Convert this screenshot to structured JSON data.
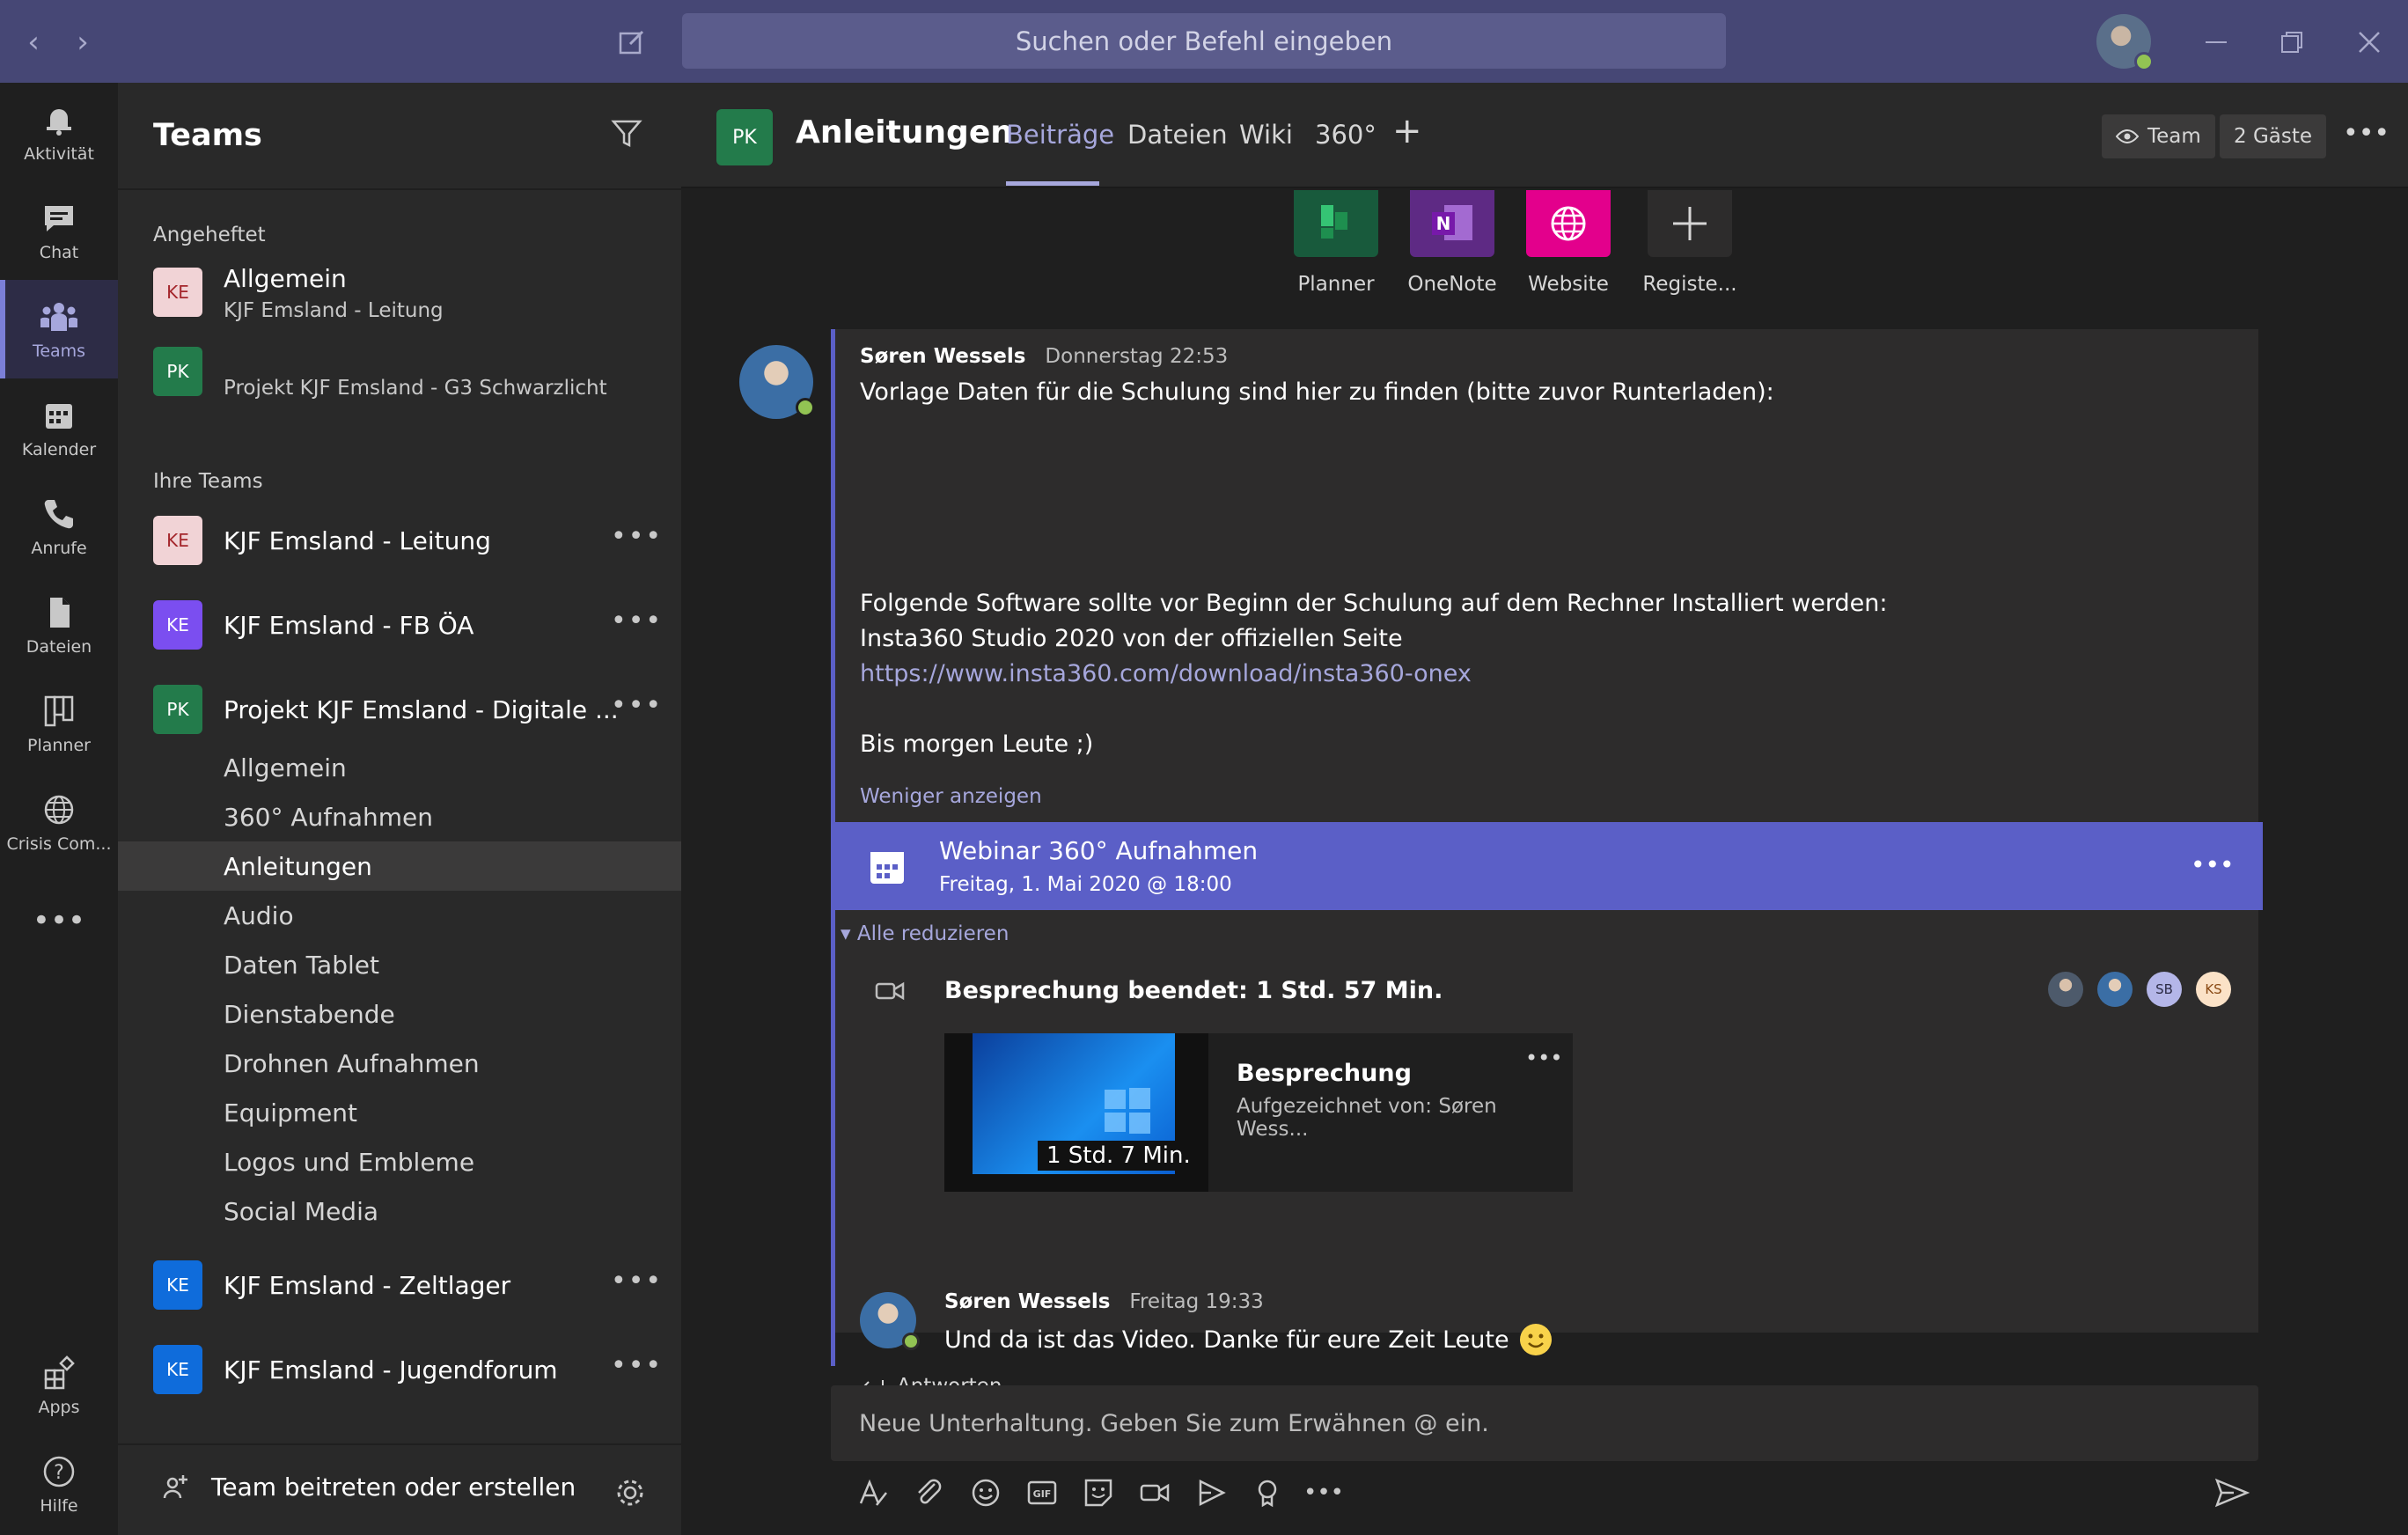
{
  "search": {
    "placeholder": "Suchen oder Befehl eingeben"
  },
  "rail": [
    {
      "label": "Aktivität",
      "icon": "bell-icon"
    },
    {
      "label": "Chat",
      "icon": "chat-icon"
    },
    {
      "label": "Teams",
      "icon": "teams-icon",
      "active": true
    },
    {
      "label": "Kalender",
      "icon": "calendar-icon"
    },
    {
      "label": "Anrufe",
      "icon": "phone-icon"
    },
    {
      "label": "Dateien",
      "icon": "file-icon"
    },
    {
      "label": "Planner",
      "icon": "planner-icon"
    },
    {
      "label": "Crisis Com...",
      "icon": "globe-icon"
    },
    {
      "label": "Apps",
      "icon": "apps-icon"
    },
    {
      "label": "Hilfe",
      "icon": "help-icon"
    }
  ],
  "pane": {
    "title": "Teams",
    "pinned_label": "Angeheftet",
    "pinned": [
      {
        "tile": "KE",
        "name": "Allgemein",
        "sub": "KJF Emsland - Leitung"
      },
      {
        "tile": "PK",
        "name": "",
        "sub": "Projekt KJF Emsland - G3 Schwarzlicht"
      }
    ],
    "your_teams_label": "Ihre Teams",
    "teams": [
      {
        "tile": "KE",
        "name": "KJF Emsland - Leitung"
      },
      {
        "tile": "KE",
        "name": "KJF Emsland - FB ÖA"
      },
      {
        "tile": "PK",
        "name": "Projekt KJF Emsland - Digitale ..."
      }
    ],
    "channels": [
      "Allgemein",
      "360° Aufnahmen",
      "Anleitungen",
      "Audio",
      "Daten Tablet",
      "Dienstabende",
      "Drohnen Aufnahmen",
      "Equipment",
      "Logos und Embleme",
      "Social Media"
    ],
    "teams_after": [
      {
        "tile": "KE",
        "name": "KJF Emsland - Zeltlager"
      },
      {
        "tile": "KE",
        "name": "KJF Emsland - Jugendforum"
      }
    ],
    "join_label": "Team beitreten oder erstellen"
  },
  "header": {
    "tile": "PK",
    "title": "Anleitungen",
    "tabs": [
      "Beiträge",
      "Dateien",
      "Wiki",
      "360°"
    ],
    "team_btn": "Team",
    "guests_btn": "2 Gäste"
  },
  "apps": [
    {
      "label": "Planner",
      "icon": "planner-app-icon"
    },
    {
      "label": "OneNote",
      "icon": "onenote-icon"
    },
    {
      "label": "Website",
      "icon": "website-globe-icon"
    },
    {
      "label": "Registe...",
      "icon": "plus-icon"
    }
  ],
  "post": {
    "author": "Søren Wessels",
    "time": "Donnerstag 22:53",
    "line1": "Vorlage Daten für die Schulung sind hier zu finden (bitte zuvor Runterladen):",
    "line2": "Folgende Software sollte vor Beginn der Schulung auf dem Rechner Installiert werden:",
    "line3": "Insta360 Studio 2020 von der offiziellen Seite",
    "link": "https://www.insta360.com/download/insta360-onex",
    "line4": "Bis morgen Leute ;)",
    "less": "Weniger anzeigen"
  },
  "event": {
    "title": "Webinar 360° Aufnahmen",
    "date": "Freitag, 1. Mai 2020 @ 18:00"
  },
  "collapse_all": "Alle reduzieren",
  "meeting": {
    "ended": "Besprechung beendet: 1 Std. 57 Min.",
    "participants": [
      "",
      "",
      "SB",
      "KS"
    ],
    "recording_title": "Besprechung",
    "recorded_by": "Aufgezeichnet von: Søren Wess...",
    "duration": "1 Std. 7 Min."
  },
  "reply": {
    "author": "Søren Wessels",
    "time": "Freitag 19:33",
    "text": "Und da ist das Video. Danke für eure Zeit Leute",
    "reply_label": "Antworten"
  },
  "composer": {
    "placeholder": "Neue Unterhaltung. Geben Sie zum Erwähnen @ ein."
  },
  "colors": {
    "accent": "#5b5fc7",
    "titlebar": "#464775",
    "online": "#92c353"
  }
}
